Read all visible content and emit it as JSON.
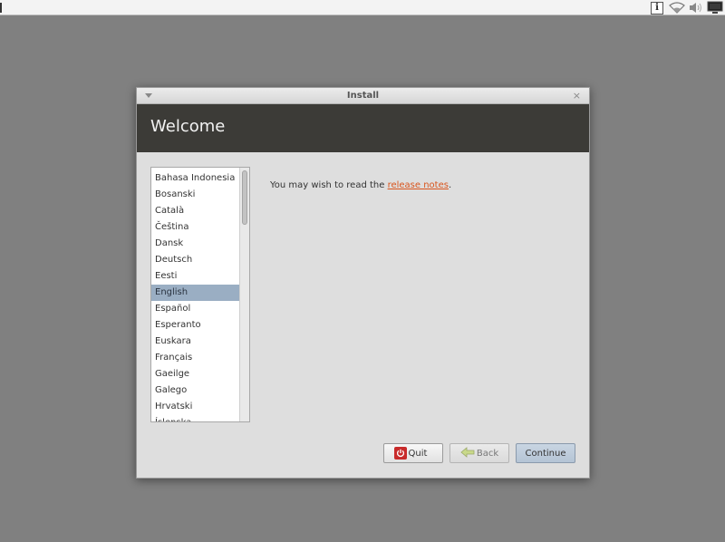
{
  "window": {
    "title": "Install",
    "close_glyph": "×"
  },
  "header": {
    "heading": "Welcome"
  },
  "languages": {
    "items": [
      "Bahasa Indonesia",
      "Bosanski",
      "Català",
      "Čeština",
      "Dansk",
      "Deutsch",
      "Eesti",
      "English",
      "Español",
      "Esperanto",
      "Euskara",
      "Français",
      "Gaeilge",
      "Galego",
      "Hrvatski",
      "Íslenska"
    ],
    "selected": "English"
  },
  "release": {
    "prefix": "You may wish to read the ",
    "link_text": "release notes",
    "suffix": "."
  },
  "buttons": {
    "quit": "Quit",
    "back": "Back",
    "continue": "Continue"
  },
  "tray": {
    "info_glyph": "i",
    "icons": [
      "info-icon",
      "wifi-icon",
      "volume-icon",
      "monitor-icon"
    ]
  },
  "colors": {
    "desktop": "#808080",
    "header_band": "#3c3b37",
    "selection": "#9aaec3",
    "link": "#d9541c",
    "quit_icon": "#c82b2b"
  }
}
